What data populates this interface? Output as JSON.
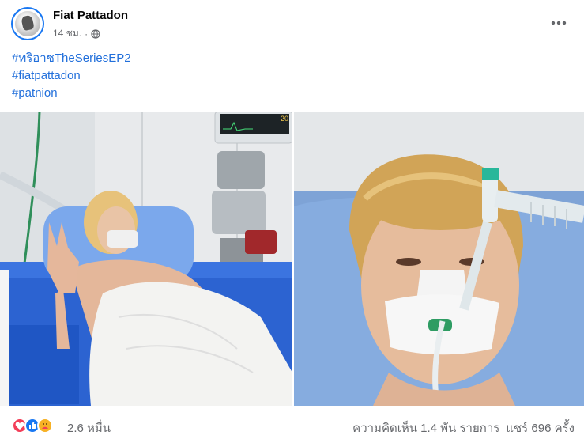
{
  "post": {
    "author": "Fiat Pattadon",
    "time": "14 ชม.",
    "separator": "·",
    "privacy_icon": "globe-icon",
    "more_icon": "more-options-icon"
  },
  "hashtags": [
    "#ทริอาชTheSeriesEP2",
    "#fiatpattadon",
    "#patnion"
  ],
  "photos": [
    {
      "name": "hospital-bed-peace-sign-photo"
    },
    {
      "name": "ventilator-closeup-photo"
    },
    {
      "monitor_text": "20"
    }
  ],
  "footer": {
    "reaction_icons": [
      "love-reaction-icon",
      "like-reaction-icon",
      "care-reaction-icon"
    ],
    "reaction_count": "2.6 หมื่น",
    "comments": "ความคิดเห็น 1.4 พัน รายการ",
    "shares": "แชร์ 696 ครั้ง"
  },
  "colors": {
    "link": "#216fdb",
    "secondary_text": "#65676b",
    "avatar_ring": "#1877f2",
    "love": "#f33e58",
    "like": "#1877f2",
    "care": "#f7b125"
  }
}
